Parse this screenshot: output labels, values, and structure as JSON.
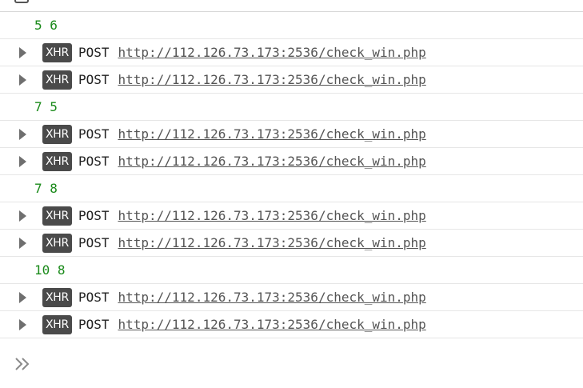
{
  "console": {
    "rows": [
      {
        "type": "log",
        "text": "5 6"
      },
      {
        "type": "xhr",
        "badge": "XHR",
        "method": "POST",
        "url": "http://112.126.73.173:2536/check_win.php"
      },
      {
        "type": "xhr",
        "badge": "XHR",
        "method": "POST",
        "url": "http://112.126.73.173:2536/check_win.php"
      },
      {
        "type": "log",
        "text": "7 5"
      },
      {
        "type": "xhr",
        "badge": "XHR",
        "method": "POST",
        "url": "http://112.126.73.173:2536/check_win.php"
      },
      {
        "type": "xhr",
        "badge": "XHR",
        "method": "POST",
        "url": "http://112.126.73.173:2536/check_win.php"
      },
      {
        "type": "log",
        "text": "7 8"
      },
      {
        "type": "xhr",
        "badge": "XHR",
        "method": "POST",
        "url": "http://112.126.73.173:2536/check_win.php"
      },
      {
        "type": "xhr",
        "badge": "XHR",
        "method": "POST",
        "url": "http://112.126.73.173:2536/check_win.php"
      },
      {
        "type": "log",
        "text": "10 8"
      },
      {
        "type": "xhr",
        "badge": "XHR",
        "method": "POST",
        "url": "http://112.126.73.173:2536/check_win.php"
      },
      {
        "type": "xhr",
        "badge": "XHR",
        "method": "POST",
        "url": "http://112.126.73.173:2536/check_win.php"
      }
    ]
  },
  "prompt": {
    "icon": "chevron-double-right-icon"
  },
  "colors": {
    "log_text": "#1a8a1a",
    "badge_bg": "#4a4a4a",
    "url": "#555555"
  }
}
